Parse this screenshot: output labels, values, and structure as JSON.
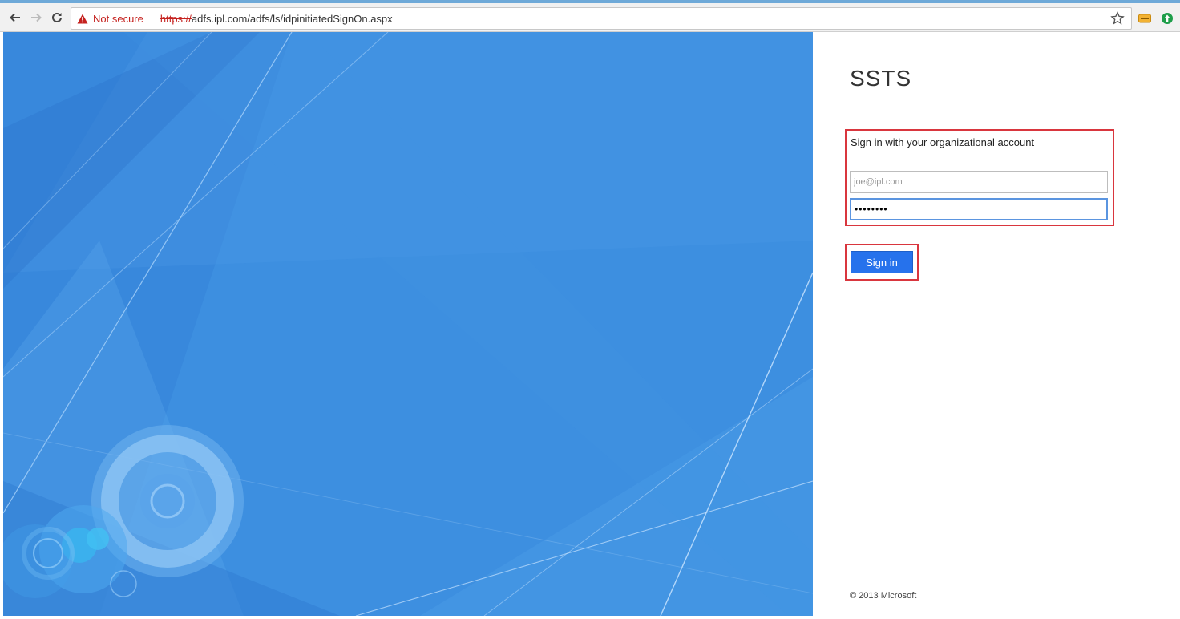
{
  "browser": {
    "security_label": "Not secure",
    "url_scheme": "https://",
    "url_rest": "adfs.ipl.com/adfs/ls/idpinitiatedSignOn.aspx",
    "icons": [
      "back-arrow-icon",
      "forward-arrow-icon",
      "reload-icon",
      "warning-icon",
      "star-icon",
      "extension-icon",
      "extension-icon"
    ]
  },
  "signin": {
    "app_title": "SSTS",
    "heading": "Sign in with your organizational account",
    "email_value": "joe@ipl.com",
    "password_value": "••••••••",
    "button_label": "Sign in",
    "footer": "© 2013 Microsoft"
  },
  "colors": {
    "accent": "#2672ec",
    "illustration_bg": "#3d8fe0",
    "highlight_border": "#d9363e",
    "not_secure": "#c5221f"
  }
}
